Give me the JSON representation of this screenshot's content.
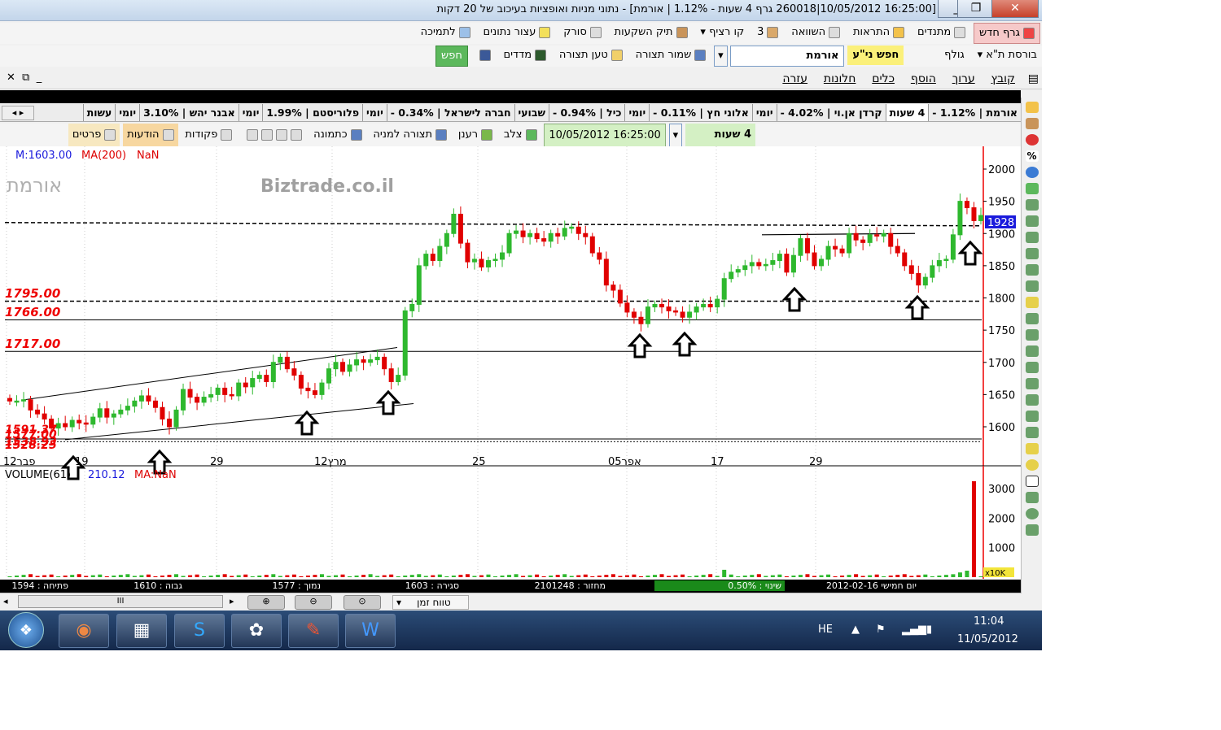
{
  "window": {
    "title": "[16:25:00 10/05/2012|260018 גרף 4 שעות - 1.12% | אורמת] - נתוני מניות ואופציות בעיכוב של 20 דקות",
    "minimize": "_",
    "maximize": "❐",
    "close": "✕"
  },
  "toolbar1": {
    "new_graph": "גרף חדש",
    "indicators": "מתנדים",
    "alerts": "התראות",
    "compare": "השוואה",
    "count": "3",
    "line_style": "קו רציף",
    "portfolio": "תיק השקעות",
    "scanner": "סורק",
    "data_wizard": "עצור נתונים",
    "support": "לתמיכה"
  },
  "toolbar_search": {
    "exchange": "בורסת ת\"א",
    "gulf": "גולף",
    "search_label": "חפש ני\"ע",
    "symbol_value": "אורמת",
    "save_layout": "שמור תצורה",
    "load_layout": "טען תצורה",
    "indices": "מדדים",
    "search_button": "חפש"
  },
  "menu": [
    "קובץ",
    "ערוך",
    "הוסף",
    "כלים",
    "חלונות",
    "עזרה"
  ],
  "ticker_tabs": [
    {
      "label": "אורמת | 1.12% -",
      "active": false
    },
    {
      "label": "4 שעות",
      "active": true
    },
    {
      "label": "קרדן אן.וי | 4.02% -",
      "active": false
    },
    {
      "label": "יומי",
      "active": false
    },
    {
      "label": "אלוני חץ | 0.11% -",
      "active": false
    },
    {
      "label": "יומי",
      "active": false
    },
    {
      "label": "כיל | 0.94% -",
      "active": false
    },
    {
      "label": "שבועי",
      "active": false
    },
    {
      "label": "חברה לישראל | 0.34% -",
      "active": false
    },
    {
      "label": "יומי",
      "active": false
    },
    {
      "label": "פלוריסטם | 1.99%",
      "active": false
    },
    {
      "label": "יומי",
      "active": false
    },
    {
      "label": "אבנר יהש | 3.10%",
      "active": false
    },
    {
      "label": "יומי",
      "active": false
    },
    {
      "label": "עשות",
      "active": false
    }
  ],
  "toolbar2": {
    "interval": "4 שעות",
    "datetime": "16:25:00 10/05/2012",
    "cross": "צלב",
    "refresh": "רענן",
    "default_layout": "תצורה למניה",
    "image": "כתמונה",
    "orders": "פקודות",
    "messages": "הודעות",
    "details": "פרטים"
  },
  "chart_header": {
    "m_value": "M:1603.00",
    "ma_label": "MA(200)",
    "ma_value": "NaN",
    "symbol_watermark": "אורמת",
    "site_watermark": "Biztrade.co.il"
  },
  "volume_header": {
    "label": "VOLUME(61)",
    "value": "210.12",
    "ma_label": "MA:NaN"
  },
  "price_levels": {
    "l1795": "1795.00",
    "l1766": "1766.00",
    "l1717": "1717.00",
    "left_stack": [
      "1591.37",
      "1577.00",
      "1538.93",
      "1528.25"
    ]
  },
  "last_price_tag": "1928",
  "x_axis_labels": [
    "12פבר",
    "19",
    "29",
    "12מרץ",
    "25",
    "05אפר",
    "17",
    "29"
  ],
  "price_axis_ticks": [
    "2000",
    "1950",
    "1900",
    "1850",
    "1800",
    "1750",
    "1700",
    "1650",
    "1600"
  ],
  "volume_axis_ticks": [
    "3000",
    "2000",
    "1000"
  ],
  "volume_scale_tag": "x10K",
  "status": {
    "open": "פתיחה : 1594",
    "high": "גבוה : 1610",
    "low": "נמוך : 1577",
    "close": "סגירה : 1603",
    "turnover": "מחזור : 2101248",
    "change": "שינוי : 0.50%",
    "date": "יום חמישי 2012-02-16"
  },
  "scroll_row": {
    "time_range": "טווח זמן",
    "scroll_thumb": "III"
  },
  "taskbar": {
    "lang": "HE",
    "time": "11:04",
    "date": "11/05/2012"
  },
  "chart_data": {
    "type": "candlestick",
    "title": "אורמת",
    "interval": "4 שעות",
    "y_range": [
      1540,
      2025
    ],
    "x_labels": [
      "12פבר",
      "19",
      "29",
      "12מרץ",
      "25",
      "05אפר",
      "17",
      "29"
    ],
    "horizontal_lines": [
      1917,
      1795,
      1766,
      1717,
      1581,
      1577
    ],
    "last_price": 1928,
    "trend_channel": {
      "upper": [
        [
          0,
          1642
        ],
        [
          80,
          1722
        ]
      ],
      "lower": [
        [
          0,
          1580
        ],
        [
          80,
          1638
        ]
      ]
    },
    "resistance_segment": 1898,
    "candles_close": [
      1640,
      1640,
      1642,
      1626,
      1620,
      1612,
      1598,
      1605,
      1600,
      1610,
      1606,
      1604,
      1615,
      1628,
      1615,
      1620,
      1626,
      1632,
      1640,
      1648,
      1640,
      1630,
      1612,
      1600,
      1626,
      1658,
      1646,
      1638,
      1646,
      1650,
      1660,
      1650,
      1648,
      1668,
      1662,
      1675,
      1680,
      1670,
      1700,
      1708,
      1690,
      1680,
      1660,
      1656,
      1650,
      1668,
      1690,
      1700,
      1686,
      1696,
      1704,
      1700,
      1704,
      1708,
      1690,
      1670,
      1680,
      1780,
      1790,
      1850,
      1868,
      1858,
      1880,
      1900,
      1930,
      1885,
      1856,
      1860,
      1848,
      1858,
      1860,
      1870,
      1900,
      1904,
      1895,
      1900,
      1892,
      1888,
      1900,
      1896,
      1908,
      1910,
      1900,
      1895,
      1870,
      1860,
      1820,
      1812,
      1792,
      1778,
      1770,
      1760,
      1786,
      1790,
      1786,
      1780,
      1778,
      1770,
      1778,
      1786,
      1790,
      1786,
      1798,
      1830,
      1840,
      1844,
      1850,
      1855,
      1850,
      1852,
      1858,
      1868,
      1840,
      1866,
      1892,
      1870,
      1850,
      1860,
      1880,
      1876,
      1870,
      1900,
      1890,
      1886,
      1898,
      1896,
      1900,
      1880,
      1870,
      1850,
      1838,
      1820,
      1832,
      1850,
      1858,
      1860,
      1898,
      1950,
      1940,
      1920,
      1928
    ],
    "volume_x10k_highlights": {
      "spike_red": 3250,
      "green_recent": 220,
      "mid_red": 250
    }
  }
}
